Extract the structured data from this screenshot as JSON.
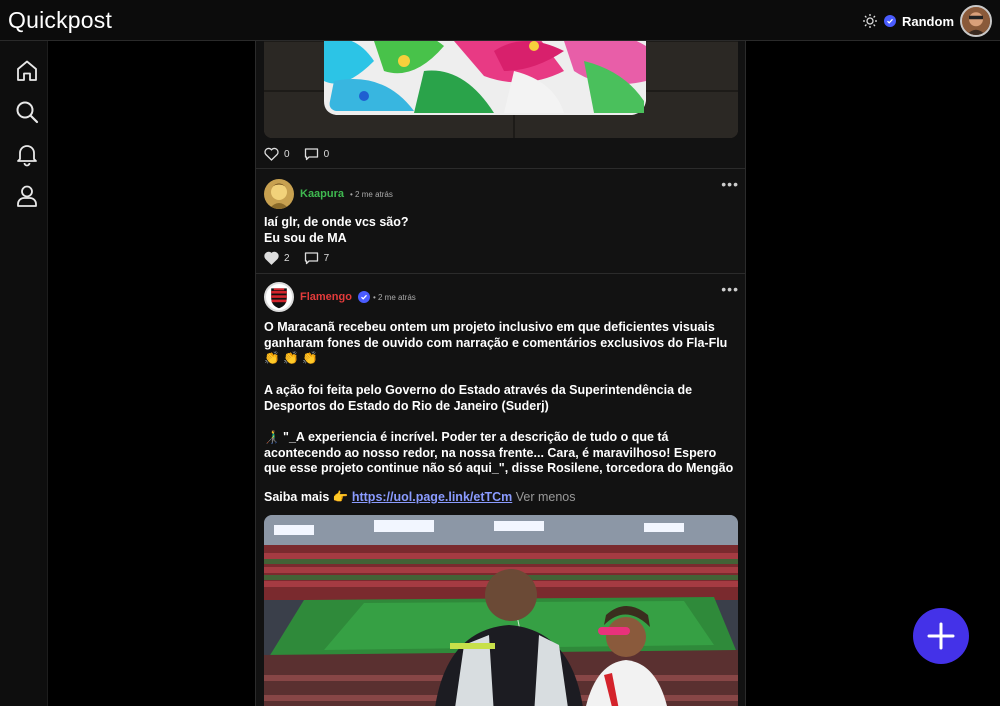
{
  "app": {
    "title": "Quickpost"
  },
  "header": {
    "username": "Random"
  },
  "sidebar": {
    "items": [
      {
        "icon": "home-icon"
      },
      {
        "icon": "search-icon"
      },
      {
        "icon": "bell-icon"
      },
      {
        "icon": "user-icon"
      }
    ]
  },
  "posts": [
    {
      "likes": "0",
      "comments": "0"
    },
    {
      "author": "Kaapura",
      "time": "• 2 me atrás",
      "text_lines": [
        "Iaí glr, de onde vcs são?",
        "Eu sou de MA"
      ],
      "likes": "2",
      "comments": "7",
      "author_color": "#3fb950"
    },
    {
      "author": "Flamengo",
      "time": "• 2 me atrás",
      "author_color": "#e23b3b",
      "paragraphs": [
        "O Maracanã recebeu ontem um projeto inclusivo em que deficientes visuais ganharam fones de ouvido com narração e comentários exclusivos do Fla-Flu 👏 👏 👏",
        "A ação foi feita pelo Governo do Estado através da Superintendência de Desportos do Estado do Rio de Janeiro (Suderj)",
        "👨‍🦯 \"_A experiencia é incrível. Poder ter a descrição de tudo o que tá acontecendo ao nosso redor, na nossa frente... Cara, é maravilhoso! Espero que esse projeto continue não só aqui_\", disse Rosilene, torcedora do Mengão"
      ],
      "saiba_prefix": "Saiba mais 👉",
      "link": "https://uol.page.link/etTCm",
      "ver_menos": "Ver menos"
    }
  ],
  "colors": {
    "accent": "#4432e8",
    "verified": "#4a5cff",
    "link": "#8a9bff"
  }
}
